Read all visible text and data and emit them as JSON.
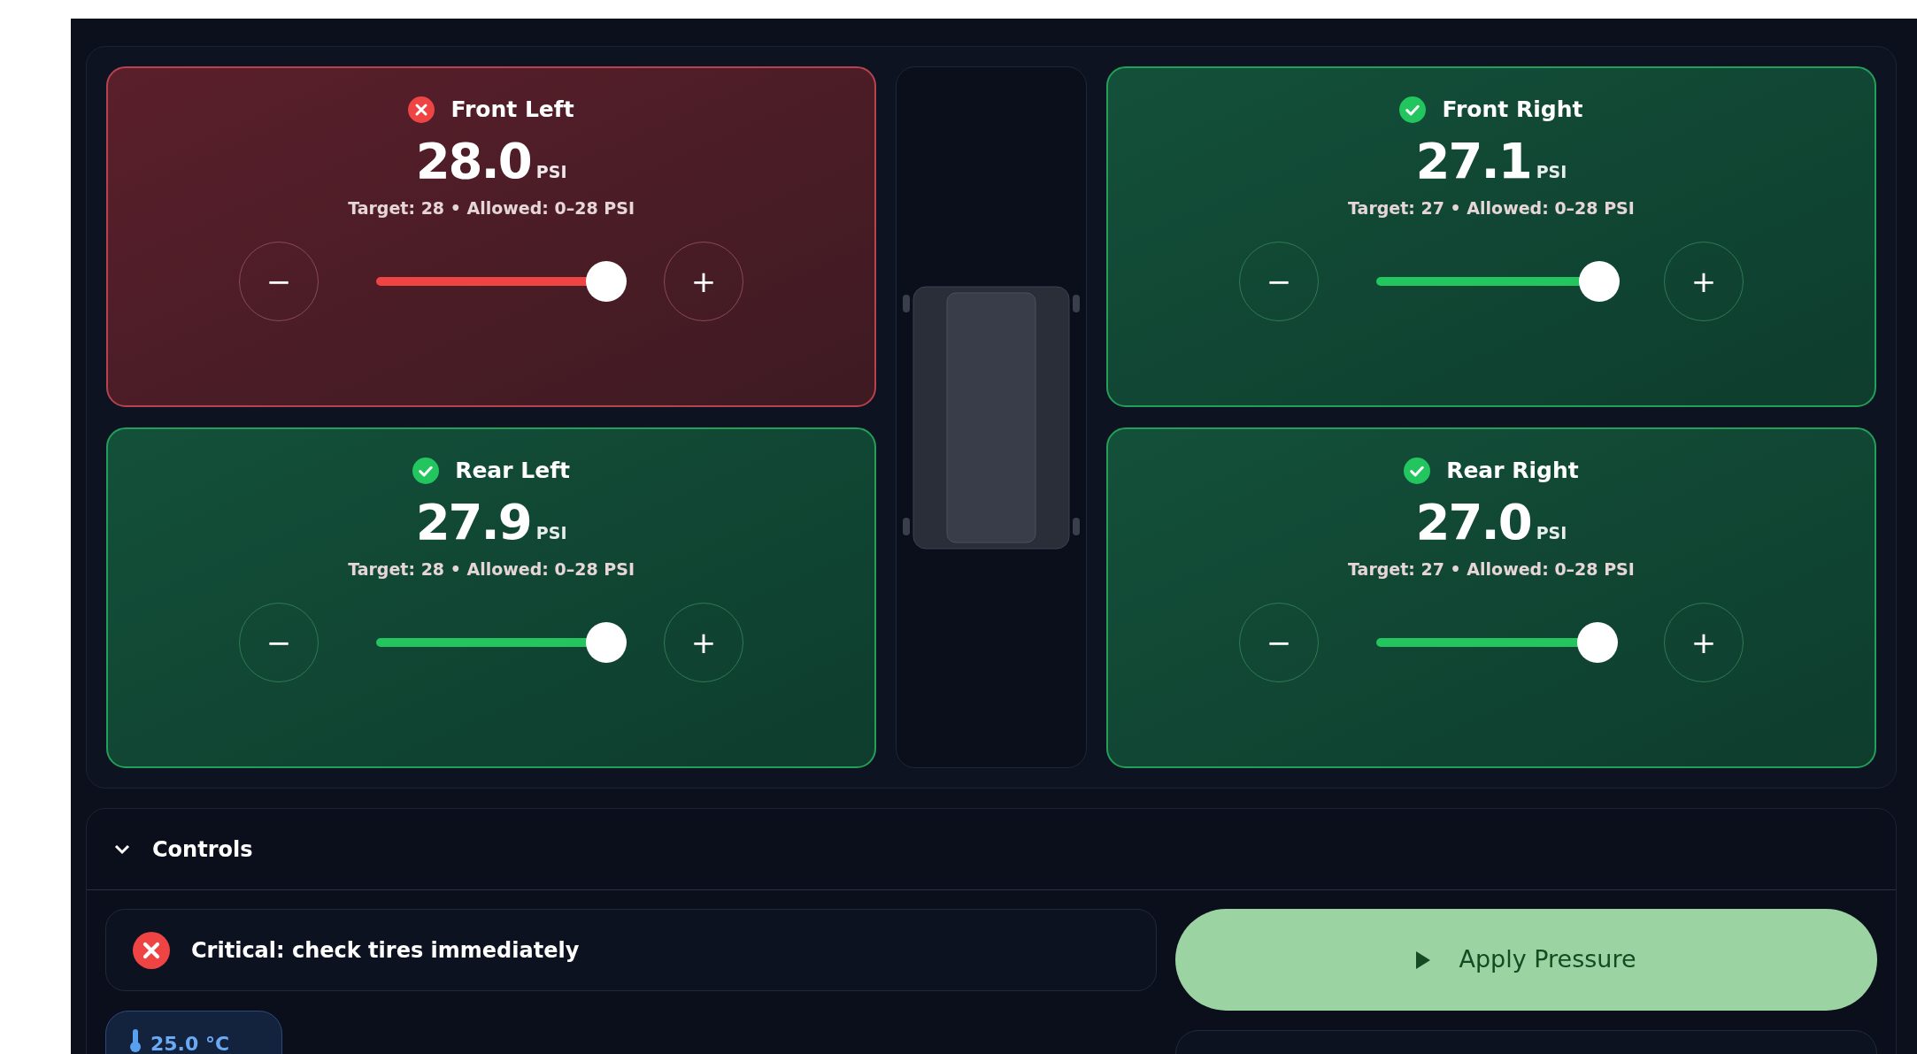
{
  "tires": [
    {
      "name": "Front Left",
      "critical": true,
      "value": "28.0",
      "unit": "PSI",
      "info": "Target: 28 • Allowed: 0–28 PSI",
      "level": 1.0,
      "minus": "−",
      "plus": "+"
    },
    {
      "name": "Front Right",
      "critical": false,
      "value": "27.1",
      "unit": "PSI",
      "info": "Target: 27 • Allowed: 0–28 PSI",
      "level": 0.97,
      "minus": "−",
      "plus": "+"
    },
    {
      "name": "Rear Left",
      "critical": false,
      "value": "27.9",
      "unit": "PSI",
      "info": "Target: 28 • Allowed: 0–28 PSI",
      "level": 1.0,
      "minus": "−",
      "plus": "+"
    },
    {
      "name": "Rear Right",
      "critical": false,
      "value": "27.0",
      "unit": "PSI",
      "info": "Target: 27 • Allowed: 0–28 PSI",
      "level": 0.96,
      "minus": "−",
      "plus": "+"
    }
  ],
  "controls": {
    "title": "Controls",
    "expanded": true,
    "alert": {
      "critical": true,
      "text": "Critical: check tires immediately"
    },
    "temperature": "25.0 °C",
    "apply_button": "Apply Pressure"
  }
}
